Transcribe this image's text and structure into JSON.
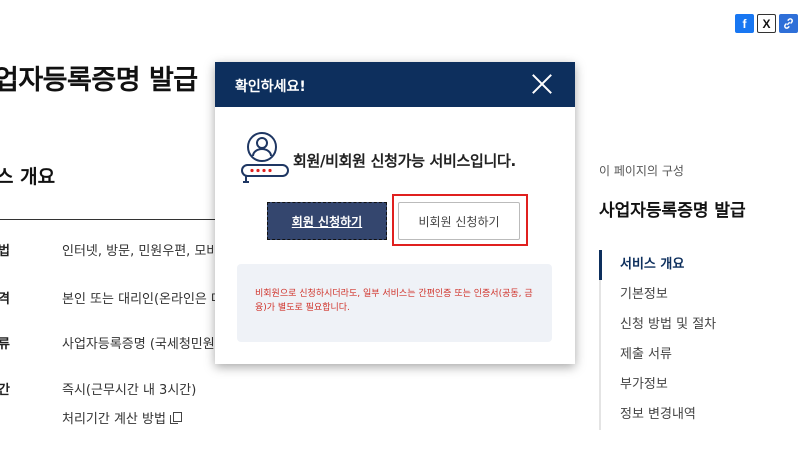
{
  "share": {
    "facebook_glyph": "f",
    "x_glyph": "X",
    "link_glyph": "🔗"
  },
  "page": {
    "title": "업자등록증명 발급",
    "section_title": "스 개요",
    "rows": [
      {
        "label": "법",
        "value": "인터넷, 방문, 민원우편, 모바일"
      },
      {
        "label": "격",
        "value": "본인 또는 대리인(온라인은 대리"
      },
      {
        "label": "류",
        "value": "사업자등록증명 (국세청민원사"
      },
      {
        "label": "간",
        "value": "즉시(근무시간 내 3시간)"
      }
    ],
    "calc_link": "처리기간 계산 방법"
  },
  "toc": {
    "caption": "이 페이지의 구성",
    "title": "사업자등록증명 발급",
    "items": [
      {
        "label": "서비스 개요",
        "active": true
      },
      {
        "label": "기본정보"
      },
      {
        "label": "신청 방법 및 절차"
      },
      {
        "label": "제출 서류"
      },
      {
        "label": "부가정보"
      },
      {
        "label": "정보 변경내역"
      }
    ]
  },
  "modal": {
    "title": "확인하세요!",
    "message": "회원/비회원 신청가능 서비스입니다.",
    "member_button": "회원 신청하기",
    "nonmember_button": "비회원 신청하기",
    "notice": "비회원으로 신청하시더라도, 일부 서비스는 간편인증 또는 인증서(공동, 금융)가 별도로 필요합니다."
  },
  "colors": {
    "header_navy": "#0d2f5d",
    "member_button": "#34466e",
    "highlight_red": "#e0201f",
    "notice_red": "#d0342c",
    "notice_bg": "#eff2f7"
  }
}
